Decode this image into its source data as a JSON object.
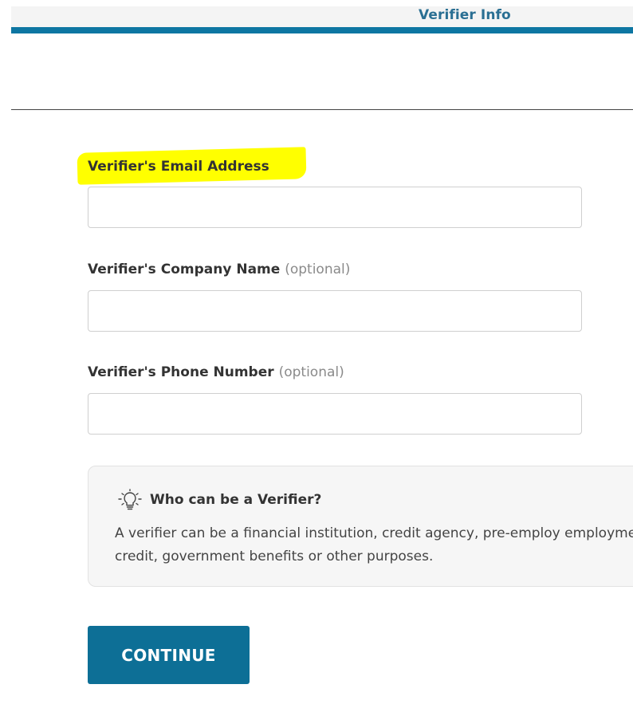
{
  "header": {
    "tab_title": "Verifier Info"
  },
  "form": {
    "email": {
      "label": "Verifier's Email Address",
      "value": "",
      "placeholder": ""
    },
    "company": {
      "label": "Verifier's Company Name",
      "optional_text": "(optional)",
      "value": "",
      "placeholder": ""
    },
    "phone": {
      "label": "Verifier's Phone Number",
      "optional_text": "(optional)",
      "value": "",
      "placeholder": ""
    }
  },
  "info": {
    "icon": "lightbulb-icon",
    "title": "Who can be a Verifier?",
    "text": "A verifier can be a financial institution, credit agency, pre-employ employment, credit, government benefits or other purposes."
  },
  "actions": {
    "continue_label": "CONTINUE"
  },
  "colors": {
    "accent": "#0d76a2",
    "button": "#0d6f96",
    "highlight": "#ffff00"
  }
}
